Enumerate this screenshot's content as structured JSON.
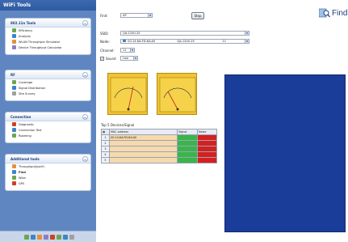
{
  "sidebar": {
    "header": "WiFi Tools",
    "panels": [
      {
        "title": "802.11n Tools",
        "items": [
          {
            "label": "Efficiency",
            "icon": "efficiency-icon",
            "color": "#6aa84f"
          },
          {
            "label": "Analysis",
            "icon": "analysis-icon",
            "color": "#3d85c6"
          },
          {
            "label": "WLAN Throughput Simulator",
            "icon": "simulator-icon",
            "color": "#e69138"
          },
          {
            "label": "Device Throughput Calculator",
            "icon": "calculator-icon",
            "color": "#8e7cc3"
          }
        ]
      },
      {
        "title": "RF",
        "items": [
          {
            "label": "Coverage",
            "icon": "coverage-icon",
            "color": "#6aa84f"
          },
          {
            "label": "Signal Distribution",
            "icon": "signal-distribution-icon",
            "color": "#3d85c6"
          },
          {
            "label": "Site Survey",
            "icon": "site-survey-icon",
            "color": "#a0a0a0"
          }
        ]
      },
      {
        "title": "Connection",
        "items": [
          {
            "label": "Diagnostic",
            "icon": "diagnostic-icon",
            "color": "#cc4125"
          },
          {
            "label": "Connection Test",
            "icon": "connection-test-icon",
            "color": "#3d85c6"
          },
          {
            "label": "Roaming",
            "icon": "roaming-icon",
            "color": "#6aa84f"
          }
        ]
      },
      {
        "title": "Additional tools",
        "items": [
          {
            "label": "Throughput(iperf)",
            "icon": "throughput-icon",
            "color": "#e69138"
          },
          {
            "label": "Find",
            "icon": "find-icon",
            "color": "#3d85c6"
          },
          {
            "label": "Wlan",
            "icon": "wlan-icon",
            "color": "#6aa84f"
          },
          {
            "label": "GPS",
            "icon": "gps-icon",
            "color": "#cc4125"
          }
        ]
      }
    ],
    "toolbar_colors": [
      "#6aa84f",
      "#3d85c6",
      "#e69138",
      "#8e7cc3",
      "#cc4125",
      "#6aa84f",
      "#3d85c6",
      "#a0a0a0"
    ]
  },
  "main": {
    "title": "Find",
    "find_label": "Find:",
    "find_value": "AP",
    "stop_label": "Stop",
    "ssid_label": "SSID:",
    "ssid_value": "QA-1200-25",
    "node_label": "Node:",
    "node_mac": "00:14:6A:FD:6A:A0",
    "node_ssid": "QA-1200-25",
    "node_channel": "11",
    "channel_label": "Channel:",
    "channel_value": "11",
    "sound_label": "Sound",
    "sound_checked": true,
    "sound_value": "Low",
    "table_title": "Top 5 Devices/Signal",
    "table_headers": [
      "",
      "MAC address",
      "Signal",
      "Noise"
    ],
    "table_rows": [
      {
        "index": "1",
        "mac": "00:14:6A:FD:6A:A0",
        "signal": "",
        "noise": ""
      },
      {
        "index": "2",
        "mac": "",
        "signal": "",
        "noise": ""
      },
      {
        "index": "3",
        "mac": "",
        "signal": "",
        "noise": ""
      },
      {
        "index": "4",
        "mac": "",
        "signal": "",
        "noise": ""
      },
      {
        "index": "5",
        "mac": "",
        "signal": "",
        "noise": ""
      }
    ],
    "accent": "#1a3d9a"
  }
}
